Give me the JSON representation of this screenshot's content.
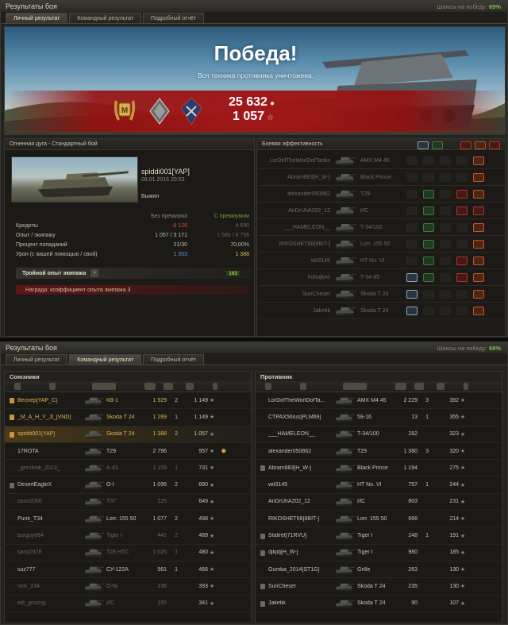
{
  "colors": {
    "accent_green": "#7fc14a",
    "victory_red": "#a0181a",
    "squad_gold": "#e0b450",
    "damage_blue": "#5a9fd9",
    "loss_red": "#d24a3a"
  },
  "top": {
    "title": "Результаты боя",
    "win_chance_label": "Шансы на победу:",
    "win_chance": "69%",
    "tabs": [
      "Личный результат",
      "Командный результат",
      "Подробный отчёт"
    ],
    "active_tab": 0,
    "banner": {
      "headline": "Победа!",
      "subline": "Вся техника противника уничтожена.",
      "credits": "25 632",
      "experience": "1 057",
      "medals": [
        "mastery-badge-icon",
        "rank-badge-icon",
        "achievement-badge-icon"
      ]
    },
    "battle_info": {
      "header": "Огненная дуга - Стандартный бой",
      "player": "spiddi001[YAP]",
      "datetime": "09.01.2016 20:53",
      "status": "Выжил",
      "col_standard": "Без премиума",
      "col_premium": "С премиумом",
      "rows": [
        {
          "label": "Кредиты",
          "standard": "-8 126",
          "premium": "4 690"
        },
        {
          "label": "Опыт / экипажу",
          "standard": "1 057 / 3 171",
          "premium": "1 586 / 4 756"
        },
        {
          "label": "Процент попаданий",
          "standard": "21/30",
          "premium": "70,00%"
        },
        {
          "label": "Урон (с вашей помощью / свой)",
          "standard": "1 353",
          "premium": "1 388"
        }
      ],
      "triple_label": "Тройной опыт экипажа",
      "triple_bonus": "103",
      "reward_label": "Награда:  коэффициент опыта экипажа 3"
    },
    "efficiency": {
      "header": "Боевая эффективность",
      "rows": [
        {
          "player": "LorDofTheWorlDofTanks",
          "vehicle": "AMX M4 45",
          "cells": [
            "",
            "",
            "",
            "",
            "o"
          ]
        },
        {
          "player": "Abram883[H_W-]",
          "vehicle": "Black Prince",
          "cells": [
            "",
            "",
            "",
            "",
            "o"
          ]
        },
        {
          "player": "alexander050862",
          "vehicle": "T29",
          "cells": [
            "",
            "g",
            "",
            "r",
            "o"
          ]
        },
        {
          "player": "AnDrUhA202_12",
          "vehicle": "ИС",
          "cells": [
            "",
            "g",
            "",
            "r",
            "r"
          ]
        },
        {
          "player": "___HAMELEON__",
          "vehicle": "T-34/100",
          "cells": [
            "",
            "g",
            "",
            "",
            "o"
          ]
        },
        {
          "player": "RIKOSHET68[8BIT-]",
          "vehicle": "Lorr. 155 50",
          "cells": [
            "",
            "g",
            "",
            "",
            "o"
          ]
        },
        {
          "player": "wit3145",
          "vehicle": "HT No. VI",
          "cells": [
            "",
            "g",
            "",
            "r",
            "o"
          ]
        },
        {
          "player": "hohojkee",
          "vehicle": "T-34-85",
          "cells": [
            "w",
            "g",
            "",
            "r",
            "o"
          ]
        },
        {
          "player": "SunCheser",
          "vehicle": "Škoda T 24",
          "cells": [
            "w",
            "",
            "",
            "",
            "o"
          ]
        },
        {
          "player": "Jaketik",
          "vehicle": "Škoda T 24",
          "cells": [
            "w",
            "",
            "",
            "",
            "o"
          ]
        }
      ]
    }
  },
  "bottom": {
    "title": "Результаты боя",
    "win_chance_label": "Шансы на победу:",
    "win_chance": "69%",
    "tabs": [
      "Личный результат",
      "Командный результат",
      "Подробный отчёт"
    ],
    "active_tab": 1,
    "allies_label": "Союзники",
    "enemies_label": "Противник",
    "allies": [
      {
        "name": "Bесnер[YAP_C]",
        "vehicle": "КВ-1",
        "dmg": "1 929",
        "frags": "2",
        "xp": "1 149",
        "squad": true,
        "alive": true
      },
      {
        "name": "_M_A_H_Y_Jl_[VND]",
        "vehicle": "Škoda T 24",
        "dmg": "1 289",
        "frags": "1",
        "xp": "1 149",
        "squad": true,
        "alive": true
      },
      {
        "name": "spiddi001[YAP]",
        "vehicle": "Škoda T 24",
        "dmg": "1 388",
        "frags": "2",
        "xp": "1 057",
        "squad": true,
        "alive": true,
        "me": true
      },
      {
        "name": "17ROTA",
        "vehicle": "T29",
        "dmg": "2 796",
        "frags": "",
        "xp": "957",
        "squad": false,
        "alive": true,
        "badge": true
      },
      {
        "name": "_greshnik_2013_",
        "vehicle": "A-43",
        "dmg": "1 159",
        "frags": "1",
        "xp": "731",
        "squad": false,
        "alive": false
      },
      {
        "name": "DesertEagleX",
        "vehicle": "O-I",
        "dmg": "1 095",
        "frags": "2",
        "xp": "680",
        "squad": false,
        "alive": true
      },
      {
        "name": "ozon2000",
        "vehicle": "T37",
        "dmg": "125",
        "frags": "",
        "xp": "649",
        "squad": false,
        "alive": false
      },
      {
        "name": "Punk_T34",
        "vehicle": "Lorr. 155 50",
        "dmg": "1 077",
        "frags": "2",
        "xp": "498",
        "squad": false,
        "alive": true
      },
      {
        "name": "burguy064",
        "vehicle": "Tiger I",
        "dmg": "442",
        "frags": "2",
        "xp": "489",
        "squad": false,
        "alive": false
      },
      {
        "name": "sany1978",
        "vehicle": "T28 HTC",
        "dmg": "1 025",
        "frags": "1",
        "xp": "480",
        "squad": false,
        "alive": false
      },
      {
        "name": "suz777",
        "vehicle": "СУ-122А",
        "dmg": "561",
        "frags": "1",
        "xp": "466",
        "squad": false,
        "alive": true
      },
      {
        "name": "nick_234",
        "vehicle": "O-Ni",
        "dmg": "238",
        "frags": "",
        "xp": "393",
        "squad": false,
        "alive": false
      },
      {
        "name": "edi_groznyj",
        "vehicle": "ИС",
        "dmg": "195",
        "frags": "",
        "xp": "341",
        "squad": false,
        "alive": false
      }
    ],
    "enemies": [
      {
        "name": "LorDofTheWorlDofTa...",
        "vehicle": "AMX M4 45",
        "dmg": "2 229",
        "frags": "3",
        "xp": "392",
        "clan": false
      },
      {
        "name": "CTPAX56rus[PLM69]",
        "vehicle": "59-16",
        "dmg": "13",
        "frags": "1",
        "xp": "355",
        "clan": false
      },
      {
        "name": "___HAMELEON__",
        "vehicle": "T-34/100",
        "dmg": "282",
        "frags": "",
        "xp": "323",
        "clan": false
      },
      {
        "name": "alexander050862",
        "vehicle": "T29",
        "dmg": "1 380",
        "frags": "3",
        "xp": "320",
        "clan": false
      },
      {
        "name": "Abram883[H_W-]",
        "vehicle": "Black Prince",
        "dmg": "1 194",
        "frags": "",
        "xp": "275",
        "clan": true
      },
      {
        "name": "wit3145",
        "vehicle": "HT No. VI",
        "dmg": "757",
        "frags": "1",
        "xp": "244",
        "clan": false
      },
      {
        "name": "AnDrUhA202_12",
        "vehicle": "ИС",
        "dmg": "803",
        "frags": "",
        "xp": "231",
        "clan": false
      },
      {
        "name": "RIKOSHET68[8BIT-]",
        "vehicle": "Lorr. 155 50",
        "dmg": "666",
        "frags": "",
        "xp": "214",
        "clan": false
      },
      {
        "name": "Stallret[71RVU]",
        "vehicle": "Tiger I",
        "dmg": "248",
        "frags": "1",
        "xp": "191",
        "clan": true
      },
      {
        "name": "djkjdj[H_W-]",
        "vehicle": "Tiger I",
        "dmg": "980",
        "frags": "",
        "xp": "185",
        "clan": true
      },
      {
        "name": "Gumba_2014[ST1G]",
        "vehicle": "Grille",
        "dmg": "263",
        "frags": "",
        "xp": "130",
        "clan": false
      },
      {
        "name": "SunCheser",
        "vehicle": "Škoda T 24",
        "dmg": "235",
        "frags": "",
        "xp": "130",
        "clan": true
      },
      {
        "name": "Jaketik",
        "vehicle": "Škoda T 24",
        "dmg": "90",
        "frags": "",
        "xp": "107",
        "clan": true
      }
    ]
  }
}
